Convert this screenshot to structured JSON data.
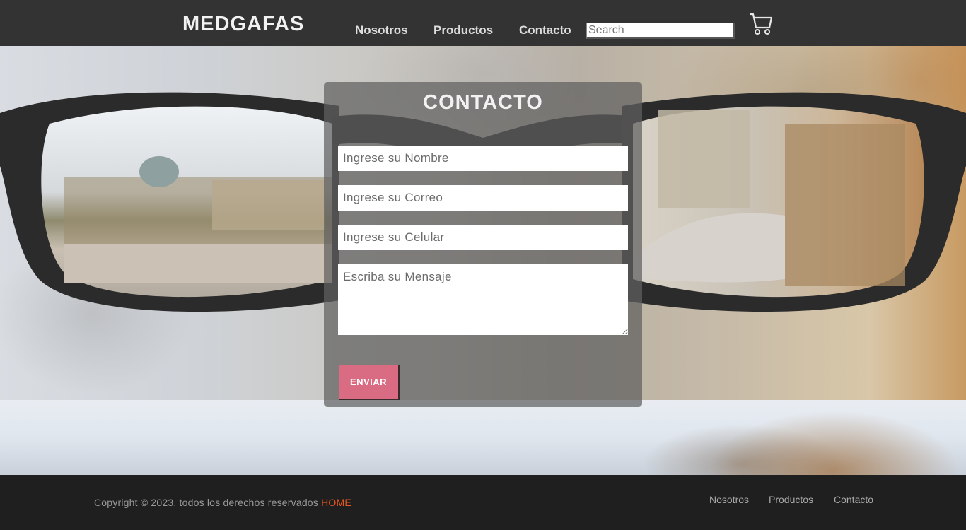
{
  "header": {
    "brand": "MEDGAFAS",
    "nav": [
      "Nosotros",
      "Productos",
      "Contacto"
    ],
    "search_placeholder": "Search",
    "cart_icon": "shopping-cart-icon"
  },
  "contact": {
    "title": "CONTACTO",
    "name_placeholder": "Ingrese su Nombre",
    "email_placeholder": "Ingrese su Correo",
    "phone_placeholder": "Ingrese su Celular",
    "message_placeholder": "Escriba su Mensaje",
    "submit_label": "ENVIAR"
  },
  "footer": {
    "copyright": "Copyright © 2023, todos los derechos reservados ",
    "home_link": "HOME",
    "links": [
      "Nosotros",
      "Productos",
      "Contacto"
    ]
  },
  "colors": {
    "header_bg": "#333333",
    "footer_bg": "#1f1f1f",
    "accent_button": "#d96b82",
    "home_link": "#e8571d"
  }
}
